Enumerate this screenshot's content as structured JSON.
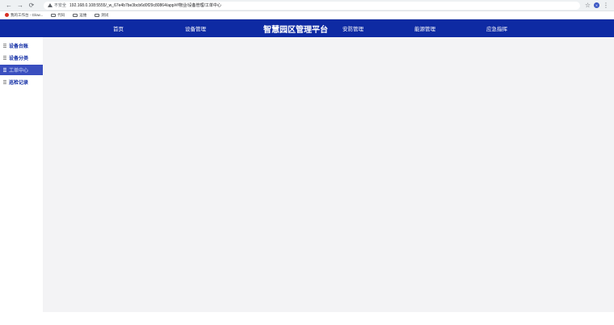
{
  "browser": {
    "back_icon": "←",
    "forward_icon": "→",
    "reload_icon": "⟳",
    "security_label": "不安全",
    "url": "192.168.0.108:5555/_w_67e4b7be3bcb6d0f29c80864/app/#/物业/设备管理/工单中心",
    "star_icon": "☆",
    "profile_initial": "X",
    "menu_icon": "⋮"
  },
  "bookmarks": [
    {
      "label": "我的工作台 - Glow...",
      "icon": "red-dot"
    },
    {
      "label": "代码",
      "icon": "folder"
    },
    {
      "label": "运维",
      "icon": "folder"
    },
    {
      "label": "测试",
      "icon": "folder"
    }
  ],
  "header": {
    "title": "智慧园区管理平台",
    "nav": {
      "home": "首页",
      "equipment": "设备管理",
      "security": "安防管理",
      "energy": "能源管理",
      "emergency": "应急指挥"
    }
  },
  "sidebar": {
    "items": [
      {
        "label": "设备台账",
        "active": false
      },
      {
        "label": "设备分类",
        "active": false
      },
      {
        "label": "工单中心",
        "active": true
      },
      {
        "label": "巡检记录",
        "active": false
      }
    ]
  },
  "colors": {
    "header_bg": "#0e2aa3",
    "active_item_bg": "#3a4fbf",
    "content_bg": "#f3f3f5"
  }
}
